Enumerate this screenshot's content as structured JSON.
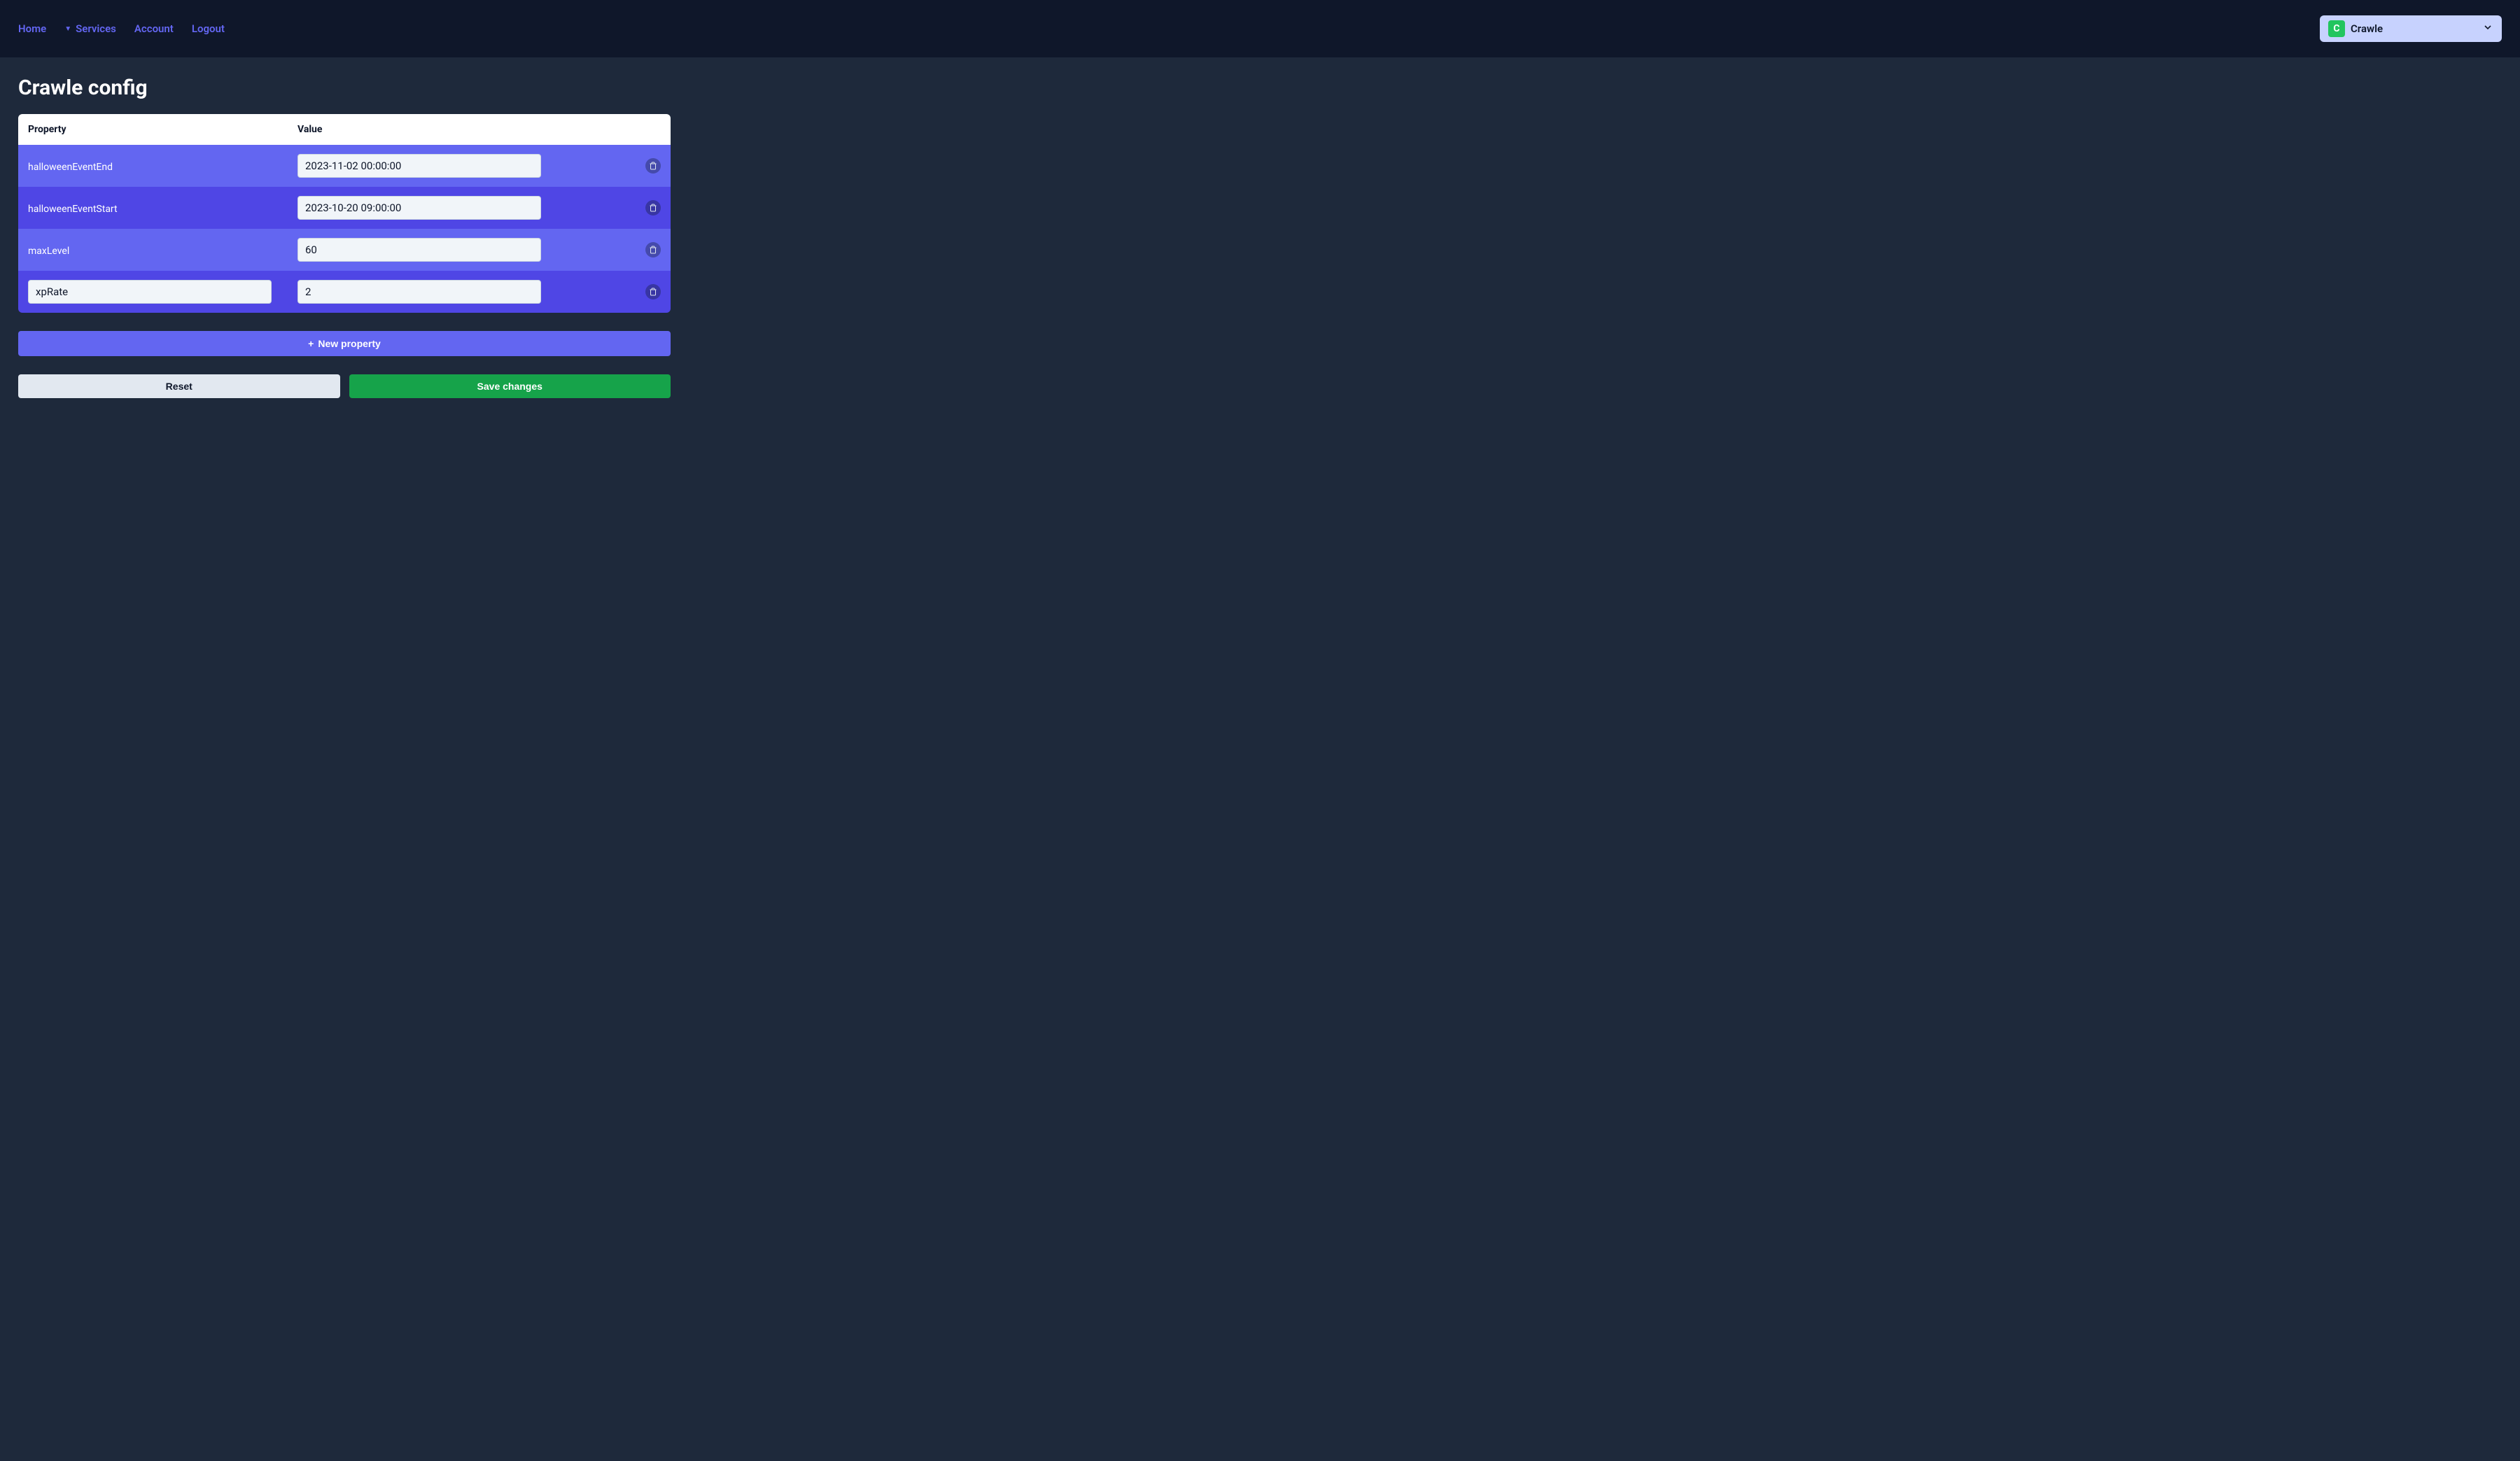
{
  "nav": {
    "home": "Home",
    "services": "Services",
    "account": "Account",
    "logout": "Logout"
  },
  "workspace": {
    "badge": "C",
    "name": "Crawle"
  },
  "page": {
    "title": "Crawle config"
  },
  "table": {
    "headers": {
      "property": "Property",
      "value": "Value"
    },
    "rows": [
      {
        "name": "halloweenEventEnd",
        "value": "2023-11-02 00:00:00",
        "editable_name": false
      },
      {
        "name": "halloweenEventStart",
        "value": "2023-10-20 09:00:00",
        "editable_name": false
      },
      {
        "name": "maxLevel",
        "value": "60",
        "editable_name": false
      },
      {
        "name": "xpRate",
        "value": "2",
        "editable_name": true
      }
    ]
  },
  "buttons": {
    "new_property": "New property",
    "reset": "Reset",
    "save": "Save changes"
  }
}
